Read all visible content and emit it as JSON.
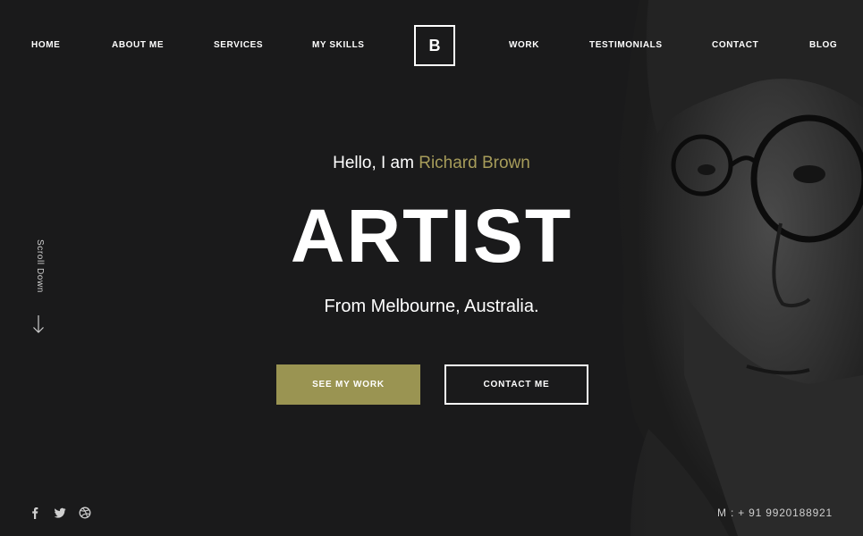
{
  "nav": {
    "items": [
      {
        "label": "HOME"
      },
      {
        "label": "ABOUT ME"
      },
      {
        "label": "SERVICES"
      },
      {
        "label": "MY SKILLS"
      },
      {
        "label": "WORK"
      },
      {
        "label": "TESTIMONIALS"
      },
      {
        "label": "CONTACT"
      },
      {
        "label": "BLOG"
      }
    ],
    "logo": "B"
  },
  "hero": {
    "greeting_prefix": "Hello, I am ",
    "greeting_name": "Richard Brown",
    "headline": "ARTIST",
    "location": "From Melbourne, Australia.",
    "primary_button": "SEE MY WORK",
    "secondary_button": "CONTACT ME"
  },
  "scroll": {
    "label": "Scroll Down"
  },
  "social": {
    "icons": [
      "facebook-icon",
      "twitter-icon",
      "dribbble-icon"
    ]
  },
  "footer": {
    "phone": "M : + 91 9920188921"
  },
  "colors": {
    "background": "#1b1b1c",
    "accent": "#9a9452",
    "accent_text": "#a79c5a",
    "text": "#ffffff"
  }
}
